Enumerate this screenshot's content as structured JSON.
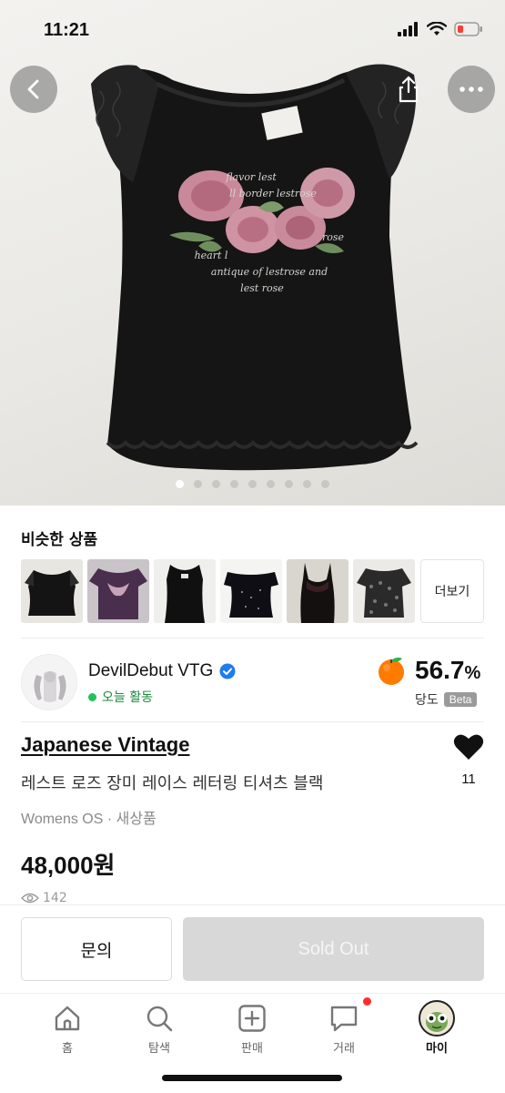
{
  "status_bar": {
    "time": "11:21"
  },
  "gallery": {
    "image_count": 9,
    "active_index": 0,
    "print_lines": [
      "flavor lest",
      "ll border lestrose",
      "heart l",
      "rose",
      "antique of lestrose and",
      "lest rose"
    ]
  },
  "similar": {
    "title": "비슷한 상품",
    "more_label": "더보기"
  },
  "seller": {
    "name": "DevilDebut VTG",
    "verified": true,
    "activity": "오늘 활동",
    "score": "56.7",
    "score_unit": "%",
    "score_label": "당도",
    "beta_label": "Beta"
  },
  "product": {
    "brand": "Japanese Vintage",
    "title": "레스트 로즈 장미 레이스 레터링 티셔츠 블랙",
    "meta": "Womens OS · 새상품",
    "price": "48,000원",
    "views": "142",
    "likes": "11"
  },
  "actions": {
    "inquire": "문의",
    "sold_out": "Sold Out"
  },
  "tabs": [
    {
      "label": "홈",
      "icon": "home-icon"
    },
    {
      "label": "탐색",
      "icon": "search-icon"
    },
    {
      "label": "판매",
      "icon": "sell-plus-icon"
    },
    {
      "label": "거래",
      "icon": "chat-icon"
    },
    {
      "label": "마이",
      "icon": "profile-avatar-icon"
    }
  ],
  "colors": {
    "accent_green": "#26c05b",
    "soldout_bg": "#d8d8d8",
    "notification": "#ff2d2d"
  }
}
